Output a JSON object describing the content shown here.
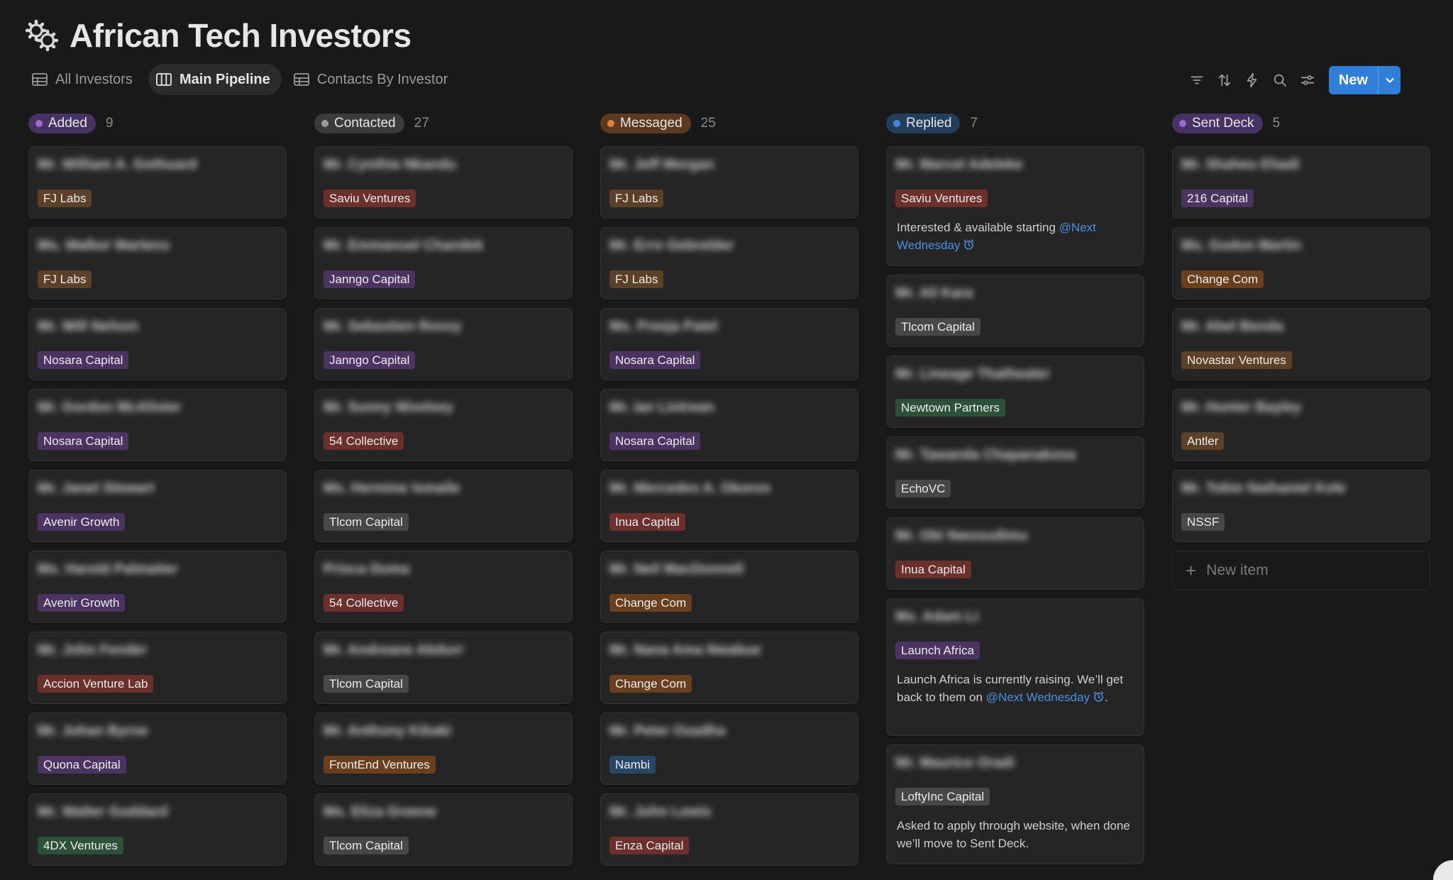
{
  "page": {
    "title": "African Tech Investors",
    "icon": "gears-icon"
  },
  "views": [
    {
      "label": "All Investors",
      "icon": "table-icon",
      "active": false
    },
    {
      "label": "Main Pipeline",
      "icon": "board-icon",
      "active": true
    },
    {
      "label": "Contacts By Investor",
      "icon": "table-icon",
      "active": false
    }
  ],
  "toolbar": {
    "new_label": "New",
    "icons": [
      "filter-icon",
      "sort-icon",
      "automation-icon",
      "search-icon",
      "settings-icon"
    ]
  },
  "tag_colors": {
    "brown": "#5c4028",
    "purple": "#4b3461",
    "red": "#6b2f2c",
    "gray": "#474747",
    "green": "#2c5138",
    "orange": "#6a3f1e",
    "blue": "#284767"
  },
  "columns": [
    {
      "name": "Added",
      "count": "9",
      "pill_color": "#463263",
      "dot_color": "#9b6bd6",
      "cards": [
        {
          "name": "Mr. William A. Gothuard",
          "tag": "FJ Labs",
          "tag_color": "brown"
        },
        {
          "name": "Ms. Walker Martens",
          "tag": "FJ Labs",
          "tag_color": "brown"
        },
        {
          "name": "Mr. Will Nelson",
          "tag": "Nosara Capital",
          "tag_color": "purple"
        },
        {
          "name": "Mr. Gordon McAlister",
          "tag": "Nosara Capital",
          "tag_color": "purple"
        },
        {
          "name": "Mr. Janet Stewart",
          "tag": "Avenir Growth",
          "tag_color": "purple"
        },
        {
          "name": "Ms. Harold Palmatier",
          "tag": "Avenir Growth",
          "tag_color": "purple"
        },
        {
          "name": "Mr. John Fender",
          "tag": "Accion Venture Lab",
          "tag_color": "red"
        },
        {
          "name": "Mr. Johan Byrne",
          "tag": "Quona Capital",
          "tag_color": "purple"
        },
        {
          "name": "Mr. Walter Goddard",
          "tag": "4DX Ventures",
          "tag_color": "green"
        }
      ]
    },
    {
      "name": "Contacted",
      "count": "27",
      "pill_color": "#3b3b3b",
      "dot_color": "#9a9a9a",
      "cards": [
        {
          "name": "Mr. Cynthia Nkandu",
          "tag": "Saviu Ventures",
          "tag_color": "red"
        },
        {
          "name": "Mr. Emmanuel Chandek",
          "tag": "Janngo Capital",
          "tag_color": "purple"
        },
        {
          "name": "Mr. Sebastien Rossy",
          "tag": "Janngo Capital",
          "tag_color": "purple"
        },
        {
          "name": "Mr. Sunny Woolsey",
          "tag": "54 Collective",
          "tag_color": "red"
        },
        {
          "name": "Ms. Hermine Ismaile",
          "tag": "Tlcom Capital",
          "tag_color": "gray"
        },
        {
          "name": "Prisca Duma",
          "tag": "54 Collective",
          "tag_color": "red"
        },
        {
          "name": "Mr. Andreane Abdurr",
          "tag": "Tlcom Capital",
          "tag_color": "gray"
        },
        {
          "name": "Mr. Anthony Kibaki",
          "tag": "FrontEnd Ventures",
          "tag_color": "orange"
        },
        {
          "name": "Ms. Eliza Greene",
          "tag": "Tlcom Capital",
          "tag_color": "gray"
        }
      ]
    },
    {
      "name": "Messaged",
      "count": "25",
      "pill_color": "#5d3a1f",
      "dot_color": "#d9843d",
      "cards": [
        {
          "name": "Mr. Jeff Morgan",
          "tag": "FJ Labs",
          "tag_color": "brown"
        },
        {
          "name": "Mr. Erro Gebrelder",
          "tag": "FJ Labs",
          "tag_color": "brown"
        },
        {
          "name": "Ms. Preeja Patel",
          "tag": "Nosara Capital",
          "tag_color": "purple"
        },
        {
          "name": "Mr. Ian Lintrean",
          "tag": "Nosara Capital",
          "tag_color": "purple"
        },
        {
          "name": "Mr. Mercedes A. Okoros",
          "tag": "Inua Capital",
          "tag_color": "red"
        },
        {
          "name": "Mr. Neil MacDonnell",
          "tag": "Change Com",
          "tag_color": "orange"
        },
        {
          "name": "Mr. Nana Ama Nwabue",
          "tag": "Change Com",
          "tag_color": "orange"
        },
        {
          "name": "Mr. Peter Osadha",
          "tag": "Nambi",
          "tag_color": "blue"
        },
        {
          "name": "Mr. John Lewis",
          "tag": "Enza Capital",
          "tag_color": "red"
        }
      ]
    },
    {
      "name": "Replied",
      "count": "7",
      "pill_color": "#233d5c",
      "dot_color": "#3f86de",
      "cards": [
        {
          "name": "Mr. Marcel Adeleke",
          "tag": "Saviu Ventures",
          "tag_color": "red",
          "note_pre": "Interested & available starting ",
          "mention": "@Next Wednesday",
          "note_post": ""
        },
        {
          "name": "Mr. Ali Kara",
          "tag": "Tlcom Capital",
          "tag_color": "gray"
        },
        {
          "name": "Mr. Lineage Thatheater",
          "tag": "Newtown Partners",
          "tag_color": "green"
        },
        {
          "name": "Mr. Tawanda Chapanakosa",
          "tag": "EchoVC",
          "tag_color": "gray"
        },
        {
          "name": "Mr. Obi Nwosudimu",
          "tag": "Inua Capital",
          "tag_color": "red"
        },
        {
          "name": "Ms. Adam Li",
          "tag": "Launch Africa",
          "tag_color": "purple",
          "note_pre": "Launch Africa is currently raising. We’ll get back to them on ",
          "mention": "@Next Wednesday",
          "note_post": "."
        },
        {
          "name": "Mr. Maurice Oradi",
          "tag": "LoftyInc Capital",
          "tag_color": "gray",
          "note_pre": "Asked to apply through website, when done we’ll move to Sent Deck.",
          "mention": "",
          "note_post": ""
        }
      ]
    },
    {
      "name": "Sent Deck",
      "count": "5",
      "pill_color": "#463263",
      "dot_color": "#9b6bd6",
      "new_item_label": "New item",
      "cards": [
        {
          "name": "Mr. Shaheu Ehadi",
          "tag": "216 Capital",
          "tag_color": "purple"
        },
        {
          "name": "Ms. Godon Martin",
          "tag": "Change Com",
          "tag_color": "orange"
        },
        {
          "name": "Mr. Abel Benda",
          "tag": "Novastar Ventures",
          "tag_color": "brown"
        },
        {
          "name": "Mr. Hunter Bayley",
          "tag": "Antler",
          "tag_color": "brown"
        },
        {
          "name": "Mr. Tobin Nathaniel Kole",
          "tag": "NSSF",
          "tag_color": "gray"
        }
      ]
    }
  ]
}
